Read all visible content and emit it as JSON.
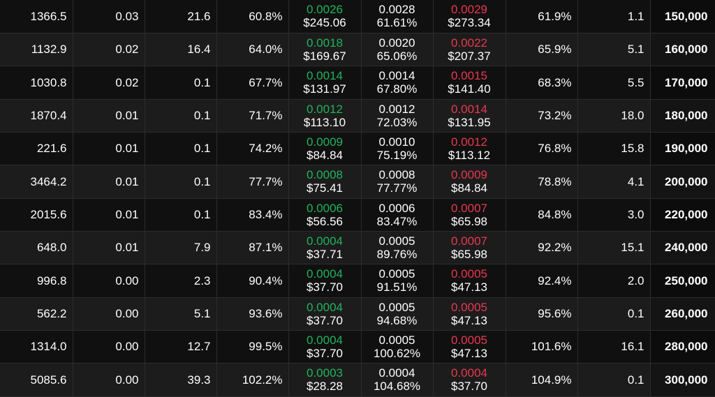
{
  "colors": {
    "bid": "#21b35c",
    "ask": "#e8384f",
    "text": "#ffffff",
    "row_dark": "#101010",
    "row_light": "#1c1c1c"
  },
  "rows": [
    {
      "c1": "1366.5",
      "c2": "0.03",
      "c3": "21.6",
      "c4": "60.8%",
      "bid": "0.0026",
      "bid_usd": "$245.06",
      "mark": "0.0028",
      "mark_iv": "61.61%",
      "ask": "0.0029",
      "ask_usd": "$273.34",
      "c8": "61.9%",
      "c9": "1.1",
      "strike": "150,000"
    },
    {
      "c1": "1132.9",
      "c2": "0.02",
      "c3": "16.4",
      "c4": "64.0%",
      "bid": "0.0018",
      "bid_usd": "$169.67",
      "mark": "0.0020",
      "mark_iv": "65.06%",
      "ask": "0.0022",
      "ask_usd": "$207.37",
      "c8": "65.9%",
      "c9": "5.1",
      "strike": "160,000"
    },
    {
      "c1": "1030.8",
      "c2": "0.02",
      "c3": "0.1",
      "c4": "67.7%",
      "bid": "0.0014",
      "bid_usd": "$131.97",
      "mark": "0.0014",
      "mark_iv": "67.80%",
      "ask": "0.0015",
      "ask_usd": "$141.40",
      "c8": "68.3%",
      "c9": "5.5",
      "strike": "170,000"
    },
    {
      "c1": "1870.4",
      "c2": "0.01",
      "c3": "0.1",
      "c4": "71.7%",
      "bid": "0.0012",
      "bid_usd": "$113.10",
      "mark": "0.0012",
      "mark_iv": "72.03%",
      "ask": "0.0014",
      "ask_usd": "$131.95",
      "c8": "73.2%",
      "c9": "18.0",
      "strike": "180,000"
    },
    {
      "c1": "221.6",
      "c2": "0.01",
      "c3": "0.1",
      "c4": "74.2%",
      "bid": "0.0009",
      "bid_usd": "$84.84",
      "mark": "0.0010",
      "mark_iv": "75.19%",
      "ask": "0.0012",
      "ask_usd": "$113.12",
      "c8": "76.8%",
      "c9": "15.8",
      "strike": "190,000"
    },
    {
      "c1": "3464.2",
      "c2": "0.01",
      "c3": "0.1",
      "c4": "77.7%",
      "bid": "0.0008",
      "bid_usd": "$75.41",
      "mark": "0.0008",
      "mark_iv": "77.77%",
      "ask": "0.0009",
      "ask_usd": "$84.84",
      "c8": "78.8%",
      "c9": "4.1",
      "strike": "200,000"
    },
    {
      "c1": "2015.6",
      "c2": "0.01",
      "c3": "0.1",
      "c4": "83.4%",
      "bid": "0.0006",
      "bid_usd": "$56.56",
      "mark": "0.0006",
      "mark_iv": "83.47%",
      "ask": "0.0007",
      "ask_usd": "$65.98",
      "c8": "84.8%",
      "c9": "3.0",
      "strike": "220,000"
    },
    {
      "c1": "648.0",
      "c2": "0.01",
      "c3": "7.9",
      "c4": "87.1%",
      "bid": "0.0004",
      "bid_usd": "$37.71",
      "mark": "0.0005",
      "mark_iv": "89.76%",
      "ask": "0.0007",
      "ask_usd": "$65.98",
      "c8": "92.2%",
      "c9": "15.1",
      "strike": "240,000"
    },
    {
      "c1": "996.8",
      "c2": "0.00",
      "c3": "2.3",
      "c4": "90.4%",
      "bid": "0.0004",
      "bid_usd": "$37.70",
      "mark": "0.0005",
      "mark_iv": "91.51%",
      "ask": "0.0005",
      "ask_usd": "$47.13",
      "c8": "92.4%",
      "c9": "2.0",
      "strike": "250,000"
    },
    {
      "c1": "562.2",
      "c2": "0.00",
      "c3": "5.1",
      "c4": "93.6%",
      "bid": "0.0004",
      "bid_usd": "$37.70",
      "mark": "0.0005",
      "mark_iv": "94.68%",
      "ask": "0.0005",
      "ask_usd": "$47.13",
      "c8": "95.6%",
      "c9": "0.1",
      "strike": "260,000"
    },
    {
      "c1": "1314.0",
      "c2": "0.00",
      "c3": "12.7",
      "c4": "99.5%",
      "bid": "0.0004",
      "bid_usd": "$37.70",
      "mark": "0.0005",
      "mark_iv": "100.62%",
      "ask": "0.0005",
      "ask_usd": "$47.13",
      "c8": "101.6%",
      "c9": "16.1",
      "strike": "280,000"
    },
    {
      "c1": "5085.6",
      "c2": "0.00",
      "c3": "39.3",
      "c4": "102.2%",
      "bid": "0.0003",
      "bid_usd": "$28.28",
      "mark": "0.0004",
      "mark_iv": "104.68%",
      "ask": "0.0004",
      "ask_usd": "$37.70",
      "c8": "104.9%",
      "c9": "0.1",
      "strike": "300,000"
    }
  ]
}
